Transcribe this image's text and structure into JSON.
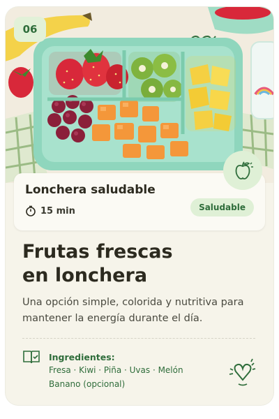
{
  "card": {
    "number": "06",
    "info": {
      "title": "Lonchera saludable",
      "time": "15 min",
      "tag": "Saludable"
    },
    "heading_line1": "Frutas frescas",
    "heading_line2": "en lonchera",
    "description": "Una opción simple, colorida y nutritiva para mantener la energía durante el día.",
    "ingredients": {
      "title": "Ingredientes:",
      "line1": "Fresa · Kiwi · Piña · Uvas · Melón",
      "line2": "Banano (opcional)"
    }
  },
  "colors": {
    "brand_green": "#2f6d3b",
    "mint_container": "#8fd6bd",
    "badge_bg": "#e2f1d8"
  },
  "icons": [
    "timer-icon",
    "apple-icon",
    "book-icon",
    "heart-doodle-icon"
  ]
}
